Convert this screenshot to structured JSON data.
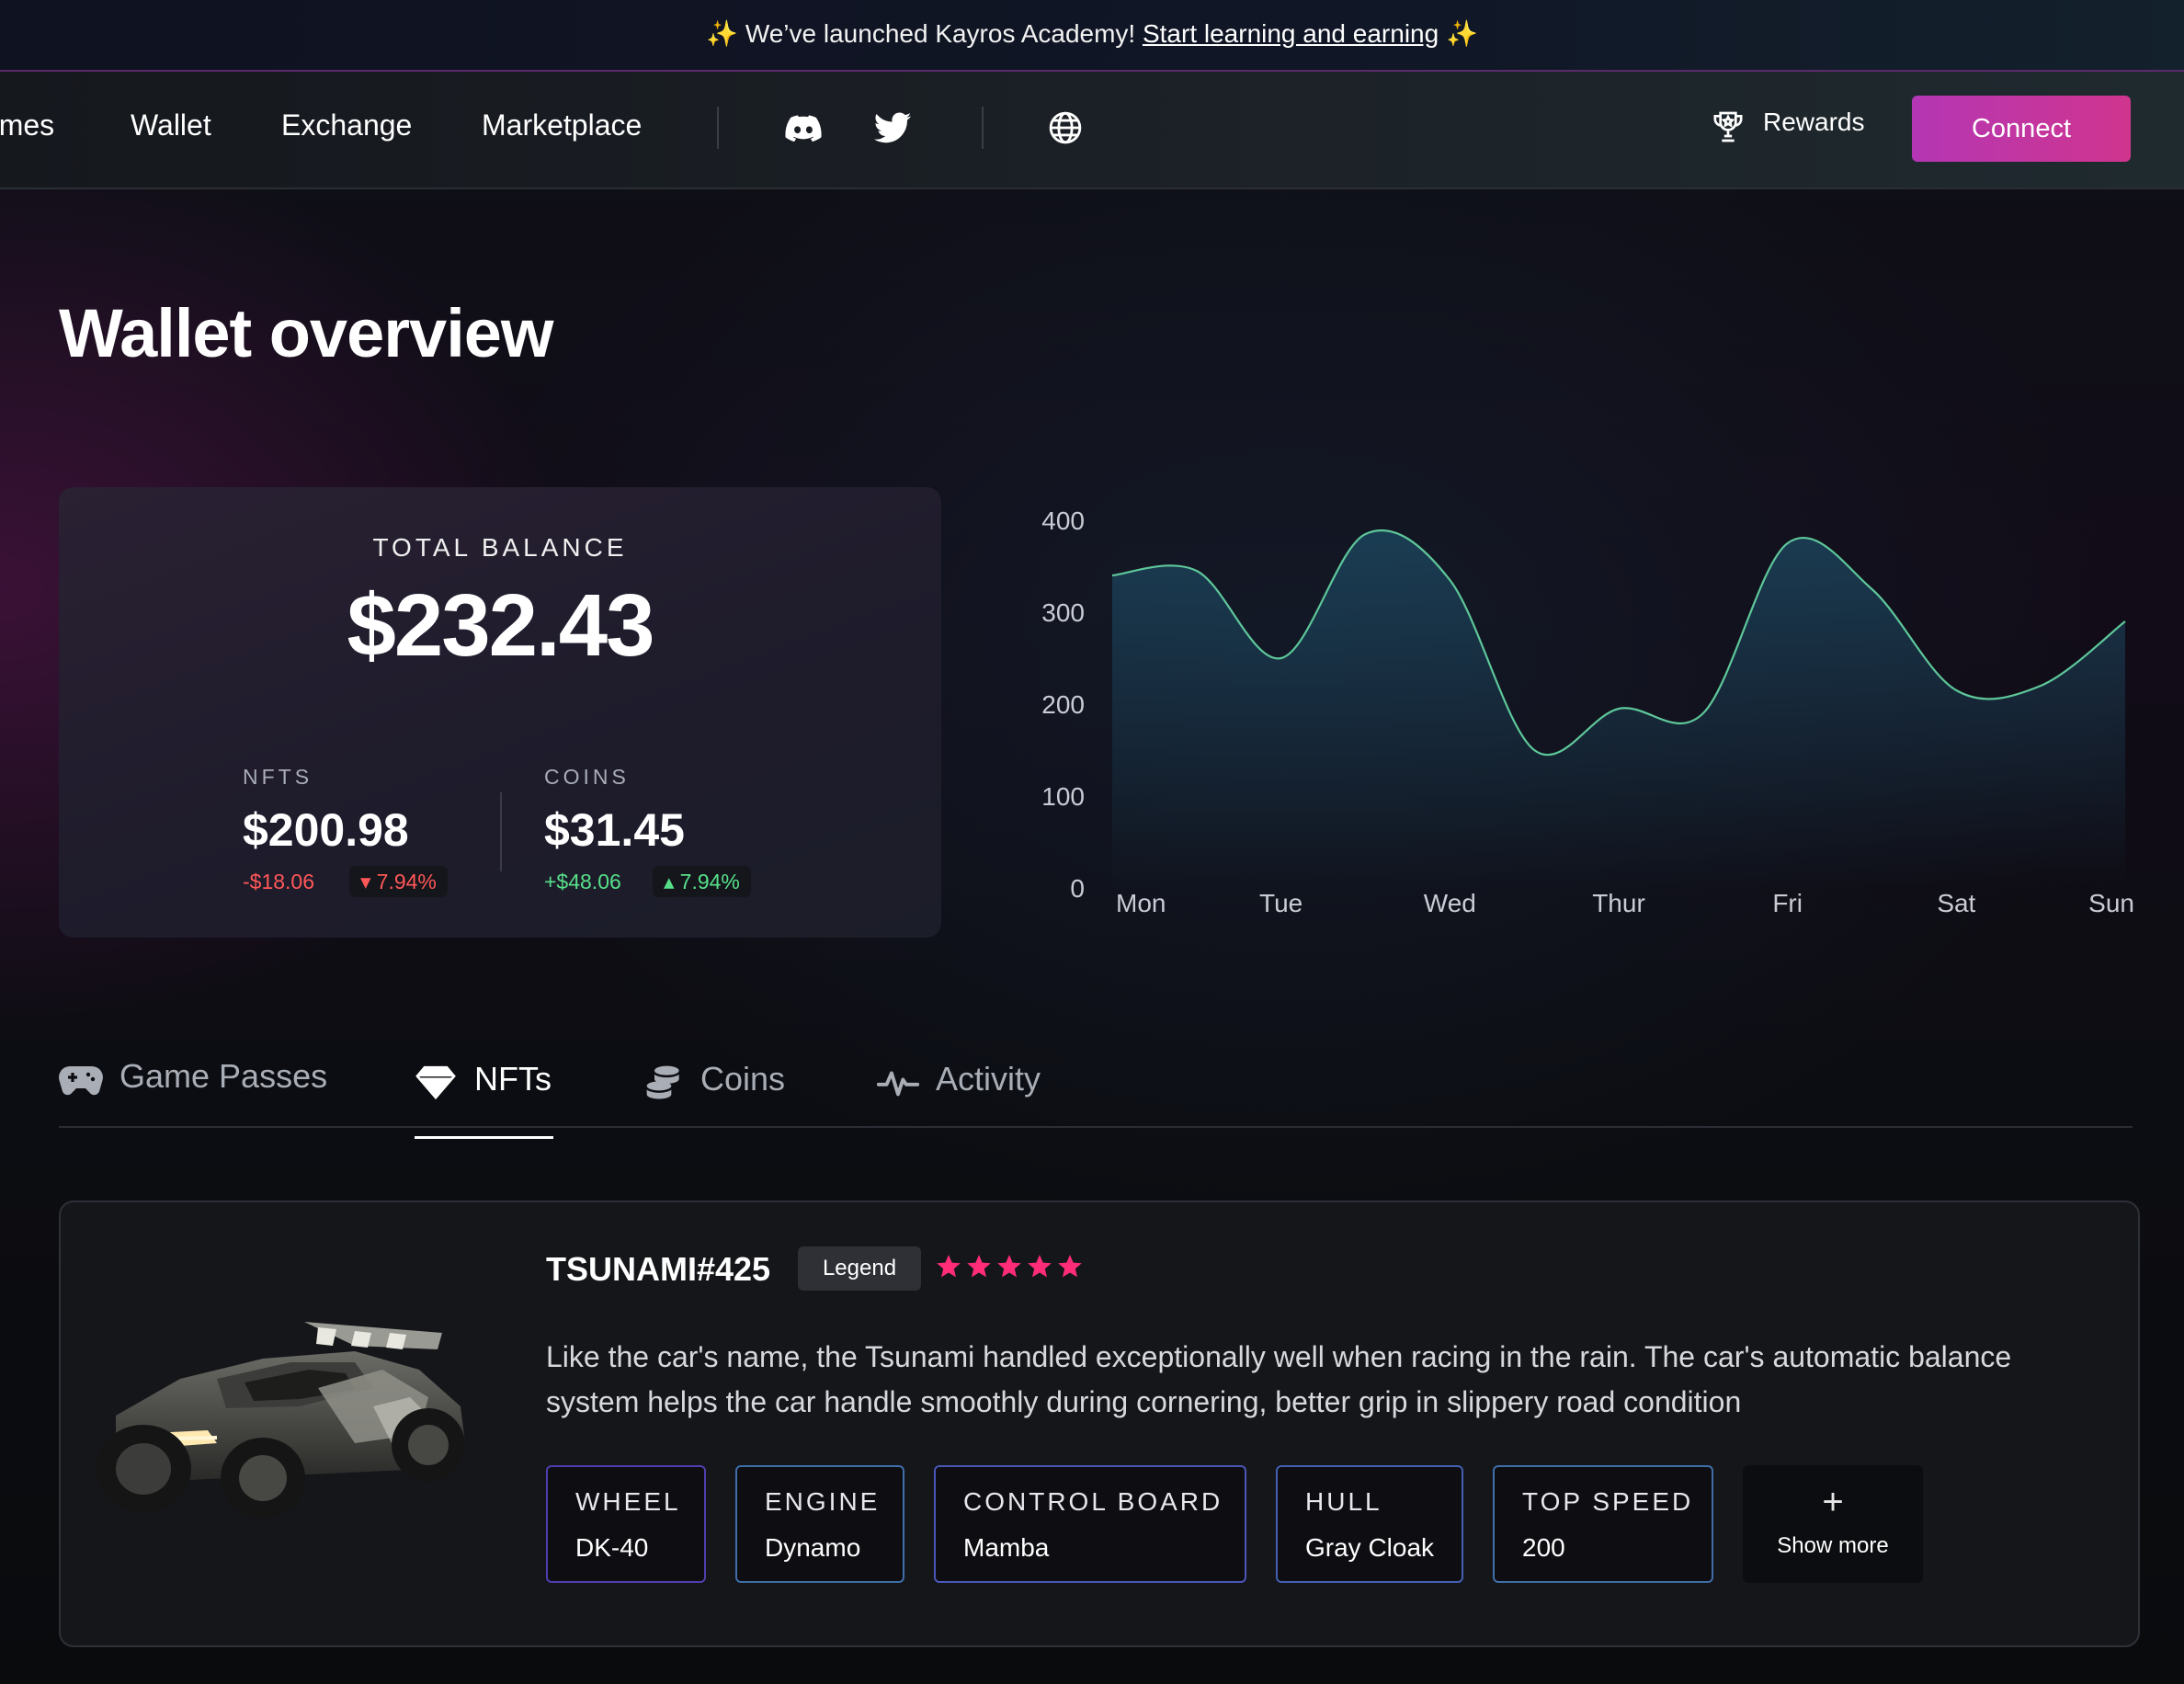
{
  "announcement": {
    "prefix": "We’ve launched Kayros Academy!",
    "link": "Start learning and earning"
  },
  "nav": {
    "links": [
      "Games",
      "Wallet",
      "Exchange",
      "Marketplace"
    ],
    "rewards_label": "Rewards",
    "connect_label": "Connect",
    "icons": [
      "discord-icon",
      "twitter-icon",
      "globe-icon",
      "trophy-icon"
    ]
  },
  "page_title": "Wallet overview",
  "balance": {
    "label": "TOTAL BALANCE",
    "total": "$232.43",
    "nfts": {
      "label": "NFTS",
      "value": "$200.98",
      "change": "-$18.06",
      "pct": "7.94%",
      "direction": "down"
    },
    "coins": {
      "label": "COINS",
      "value": "$31.45",
      "change": "+$48.06",
      "pct": "7.94%",
      "direction": "up"
    }
  },
  "chart_data": {
    "type": "area",
    "categories": [
      "Mon",
      "Tue",
      "Wed",
      "Thur",
      "Fri",
      "Sat",
      "Sun"
    ],
    "x": [
      0,
      0.5,
      1,
      1.5,
      2,
      2.5,
      3,
      3.5,
      4,
      4.5,
      5,
      5.5,
      6
    ],
    "values": [
      340,
      345,
      250,
      385,
      335,
      150,
      195,
      190,
      375,
      325,
      215,
      220,
      290
    ],
    "yticks": [
      "0",
      "100",
      "200",
      "300",
      "400"
    ],
    "ylim": [
      0,
      400
    ],
    "line_color": "#5ec79a",
    "fill_color": "#1d4a63",
    "title": "",
    "xlabel": "",
    "ylabel": "",
    "grid": false
  },
  "tabs": [
    {
      "label": "Game Passes",
      "icon": "gamepad-icon",
      "active": false
    },
    {
      "label": "NFTs",
      "icon": "diamond-icon",
      "active": true
    },
    {
      "label": "Coins",
      "icon": "coins-icon",
      "active": false
    },
    {
      "label": "Activity",
      "icon": "activity-icon",
      "active": false
    }
  ],
  "nft": {
    "name": "TSUNAMI#425",
    "rarity": "Legend",
    "stars": 5,
    "star_color": "#ff2d78",
    "description": "Like the car's name, the Tsunami handled exceptionally well when racing in the rain. The car's automatic balance system helps the car handle smoothly during cornering, better grip in slippery road condition",
    "attributes": [
      {
        "key": "WHEEL",
        "value": "DK-40"
      },
      {
        "key": "ENGINE",
        "value": "Dynamo"
      },
      {
        "key": "CONTROL BOARD",
        "value": "Mamba"
      },
      {
        "key": "HULL",
        "value": "Gray Cloak"
      },
      {
        "key": "TOP SPEED",
        "value": "200"
      }
    ],
    "show_more": {
      "symbol": "+",
      "label": "Show more"
    }
  },
  "colors": {
    "accent": "#c436a8",
    "positive": "#57e08a",
    "negative": "#ff5757"
  }
}
